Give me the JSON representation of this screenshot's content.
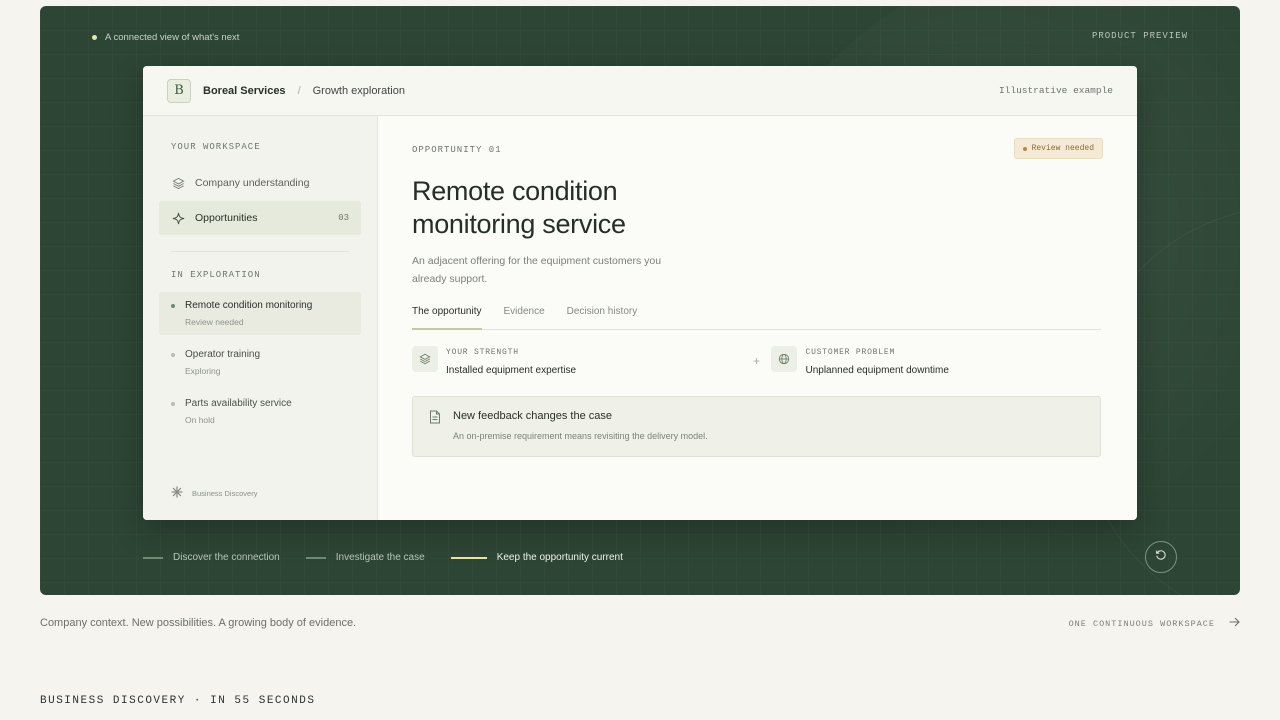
{
  "hero": {
    "tagline": "A connected view of what's next",
    "preview_label": "PRODUCT PREVIEW"
  },
  "window": {
    "logo_letter": "B",
    "org_name": "Boreal Services",
    "breadcrumb_sep": "/",
    "breadcrumb": "Growth exploration",
    "illustrative": "Illustrative example"
  },
  "sidebar": {
    "workspace_heading": "YOUR WORKSPACE",
    "items": [
      {
        "label": "Company understanding",
        "icon": "layers-icon"
      },
      {
        "label": "Opportunities",
        "icon": "sparkle-icon",
        "count": "03"
      }
    ],
    "exploration_heading": "IN EXPLORATION",
    "explorations": [
      {
        "label": "Remote condition monitoring",
        "status": "Review needed"
      },
      {
        "label": "Operator training",
        "status": "Exploring"
      },
      {
        "label": "Parts availability service",
        "status": "On hold"
      }
    ],
    "footer": "Business Discovery"
  },
  "main": {
    "opportunity_label": "OPPORTUNITY 01",
    "badge": "Review needed",
    "title": "Remote condition monitoring service",
    "description": "An adjacent offering for the equipment customers you already support.",
    "tabs": [
      "The opportunity",
      "Evidence",
      "Decision history"
    ],
    "strength_label": "YOUR STRENGTH",
    "strength_value": "Installed equipment expertise",
    "plus": "+",
    "problem_label": "CUSTOMER PROBLEM",
    "problem_value": "Unplanned equipment downtime",
    "feedback_title": "New feedback changes the case",
    "feedback_sub": "An on-premise requirement means revisiting the delivery model."
  },
  "steps": [
    "Discover the connection",
    "Investigate the case",
    "Keep the opportunity current"
  ],
  "below": {
    "context": "Company context. New possibilities. A growing body of evidence.",
    "continuous": "ONE CONTINUOUS WORKSPACE",
    "footer_title": "BUSINESS DISCOVERY · IN 55 SECONDS"
  },
  "colors": {
    "hero_bg": "#2d4535",
    "page_bg": "#f5f4ef",
    "accent_step": "#e6e3a6",
    "badge_bg": "#f4ead6"
  }
}
